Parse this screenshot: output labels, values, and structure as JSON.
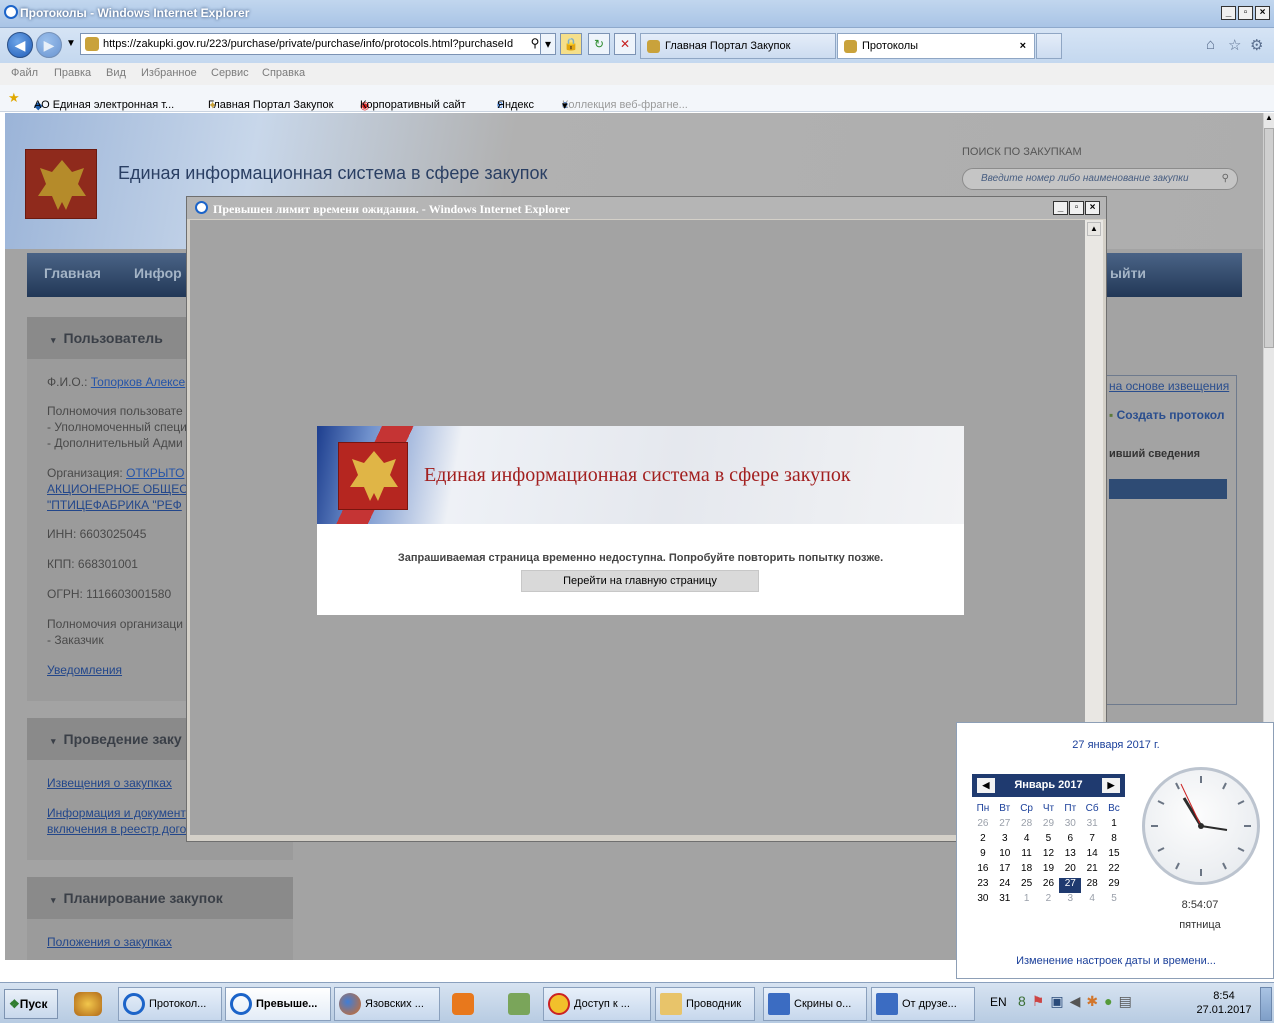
{
  "browser": {
    "title": "Протоколы - Windows Internet Explorer",
    "url": "https://zakupki.gov.ru/223/purchase/private/purchase/info/protocols.html?purchaseId",
    "tabs": [
      {
        "label": "Главная Портал Закупок"
      },
      {
        "label": "Протоколы"
      }
    ],
    "menu": [
      "Файл",
      "Правка",
      "Вид",
      "Избранное",
      "Сервис",
      "Справка"
    ],
    "favorites": [
      {
        "label": "АО Единая электронная т..."
      },
      {
        "label": "Главная Портал Закупок"
      },
      {
        "label": "Корпоративный сайт"
      },
      {
        "label": "Яндекс"
      },
      {
        "label": "Коллекция веб-фрагне..."
      }
    ]
  },
  "site": {
    "title": "Единая информационная система в сфере закупок",
    "search_label": "ПОИСК ПО ЗАКУПКАМ",
    "search_placeholder": "Введите номер либо наименование закупки",
    "nav": [
      "Главная",
      "Инфор",
      "ыйти"
    ],
    "user_section": {
      "header": "Пользователь",
      "fio_label": "Ф.И.О.:",
      "fio_value": "Топорков Алексе",
      "powers_label": "Полномочия пользовате",
      "powers": [
        "- Уполномоченный специ",
        "- Дополнительный Адми"
      ],
      "org_label": "Организация:",
      "org_lines": [
        "ОТКРЫТО",
        "АКЦИОНЕРНОЕ ОБЩЕС",
        "\"ПТИЦЕФАБРИКА \"РЕФ"
      ],
      "inn": "ИНН: 6603025045",
      "kpp": "КПП: 668301001",
      "ogrn": "ОГРН: 1116603001580",
      "org_powers_label": "Полномочия организаци",
      "org_powers": "- Заказчик",
      "notifications": "Уведомления"
    },
    "procurement_section": {
      "header": "Проведение заку",
      "links": [
        "Извещения о закупках",
        "Информация и документ",
        "включения в реестр дого"
      ]
    },
    "planning_section": {
      "header": "Планирование закупок",
      "links": [
        "Положения о закупках"
      ]
    },
    "right_panel": {
      "link": "на основе извещения",
      "create": "Создать протокол",
      "note": "ивший сведения"
    }
  },
  "modal": {
    "title": "Превышен лимит времени ожидания. - Windows Internet Explorer",
    "banner_title": "Единая информационная система в сфере закупок",
    "message": "Запрашиваемая страница временно недоступна. Попробуйте повторить попытку позже.",
    "button": "Перейти на главную страницу"
  },
  "clock": {
    "date_long": "27 января 2017 г.",
    "month": "Январь 2017",
    "weekdays": [
      "Пн",
      "Вт",
      "Ср",
      "Чт",
      "Пт",
      "Сб",
      "Вс"
    ],
    "weeks": [
      [
        "26",
        "27",
        "28",
        "29",
        "30",
        "31",
        "1"
      ],
      [
        "2",
        "3",
        "4",
        "5",
        "6",
        "7",
        "8"
      ],
      [
        "9",
        "10",
        "11",
        "12",
        "13",
        "14",
        "15"
      ],
      [
        "16",
        "17",
        "18",
        "19",
        "20",
        "21",
        "22"
      ],
      [
        "23",
        "24",
        "25",
        "26",
        "27",
        "28",
        "29"
      ],
      [
        "30",
        "31",
        "1",
        "2",
        "3",
        "4",
        "5"
      ]
    ],
    "time": "8:54:07",
    "weekday": "пятница",
    "settings_link": "Изменение настроек даты и времени..."
  },
  "taskbar": {
    "start": "Пуск",
    "items": [
      {
        "label": "Протокол..."
      },
      {
        "label": "Превыше..."
      },
      {
        "label": "Язовских ..."
      },
      {
        "label": "Доступ к ..."
      },
      {
        "label": "Проводник"
      },
      {
        "label": "Скрины о..."
      },
      {
        "label": "От друзе..."
      }
    ],
    "lang": "EN",
    "tray_time": "8:54",
    "tray_date": "27.01.2017"
  },
  "colors": {
    "ie_blue": "#1f5cb8",
    "site_red": "#a21f1f",
    "menu_dark": "#223857"
  }
}
